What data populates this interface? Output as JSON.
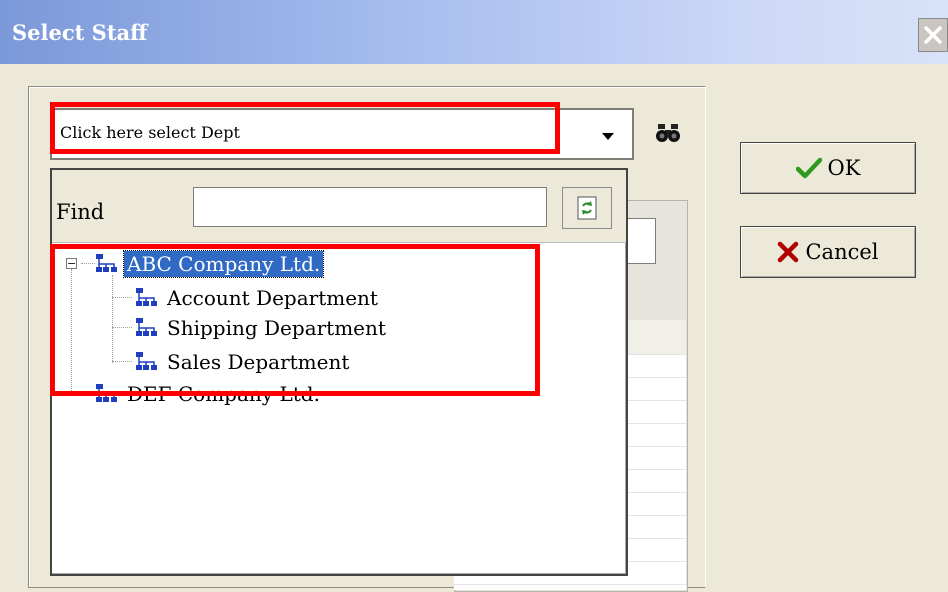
{
  "window": {
    "title": "Select Staff"
  },
  "combo": {
    "value": "Click here select Dept"
  },
  "find": {
    "label": "Find",
    "value": ""
  },
  "tree": {
    "root": {
      "label": "ABC Company Ltd."
    },
    "children": [
      {
        "label": "Account Department"
      },
      {
        "label": "Shipping Department"
      },
      {
        "label": "Sales Department"
      }
    ],
    "sibling": {
      "label": "DEF Company Ltd."
    }
  },
  "buttons": {
    "ok": "OK",
    "cancel": "Cancel"
  },
  "colors": {
    "highlight": "#316ac5",
    "annotation": "#ff0000",
    "ok_check": "#2e9a1f",
    "cancel_x": "#b00000"
  },
  "icons": [
    "close-icon",
    "dropdown-arrow-icon",
    "binoculars-icon",
    "refresh-icon",
    "org-tree-icon",
    "checkmark-icon",
    "x-icon"
  ]
}
